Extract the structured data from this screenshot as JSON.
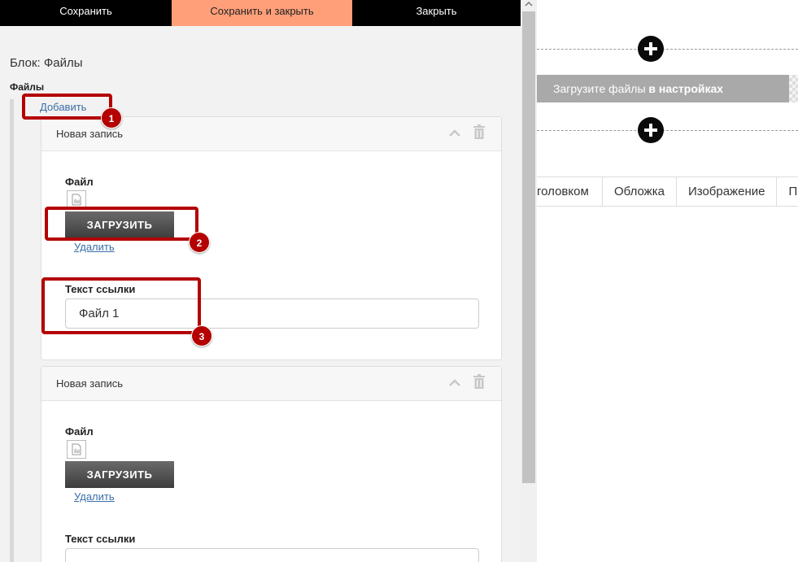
{
  "toolbar": {
    "save": "Сохранить",
    "save_close": "Сохранить и закрыть",
    "close": "Закрыть"
  },
  "block_title": "Блок: Файлы",
  "section_label": "Файлы",
  "add_link": "Добавить",
  "records": [
    {
      "title": "Новая запись",
      "file_label": "Файл",
      "upload_label": "ЗАГРУЗИТЬ",
      "delete_label": "Удалить",
      "link_text_label": "Текст ссылки",
      "link_text_value": "Файл 1"
    },
    {
      "title": "Новая запись",
      "file_label": "Файл",
      "upload_label": "ЗАГРУЗИТЬ",
      "delete_label": "Удалить",
      "link_text_label": "Текст ссылки",
      "link_text_value": ""
    }
  ],
  "annotations": [
    "1",
    "2",
    "3"
  ],
  "preview": {
    "upload_prefix": "Загрузите файлы ",
    "upload_bold": "в настройках",
    "tabs": [
      "головком",
      "Обложка",
      "Изображение",
      "П"
    ]
  },
  "colors": {
    "accent": "#ff9f7a",
    "annotation": "#b40000",
    "link": "#3a6ea8"
  },
  "icons": [
    "chevron-up-icon",
    "trash-icon",
    "file-icon",
    "plus-icon",
    "scroll-up-arrow-icon"
  ]
}
